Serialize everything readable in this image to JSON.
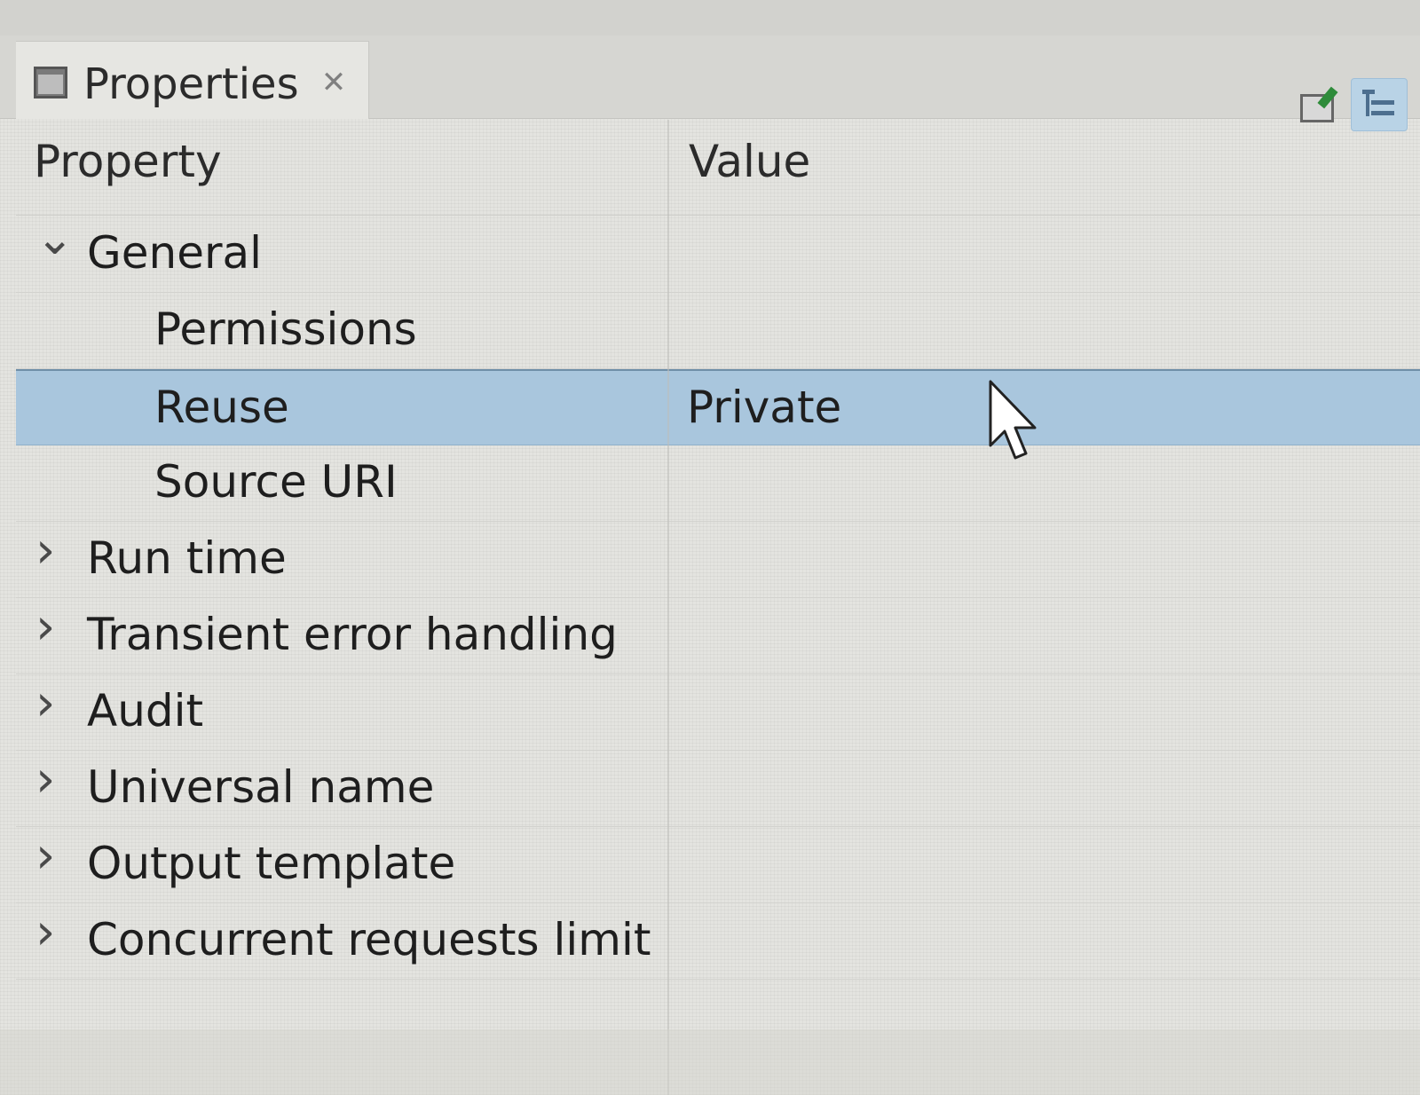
{
  "tab": {
    "title": "Properties",
    "icon": "properties-view-icon",
    "close_icon": "close-icon"
  },
  "toolbar": {
    "buttons": [
      {
        "icon": "edit-icon"
      },
      {
        "icon": "tree-view-icon",
        "active": true
      }
    ]
  },
  "table": {
    "headers": {
      "property": "Property",
      "value": "Value"
    },
    "rows": [
      {
        "label": "General",
        "value": "",
        "expandable": true,
        "expanded": true,
        "level": 0
      },
      {
        "label": "Permissions",
        "value": "",
        "level": 1
      },
      {
        "label": "Reuse",
        "value": "Private",
        "level": 1,
        "selected": true
      },
      {
        "label": "Source URI",
        "value": "",
        "level": 1
      },
      {
        "label": "Run time",
        "value": "",
        "expandable": true,
        "expanded": false,
        "level": 0
      },
      {
        "label": "Transient error handling",
        "value": "",
        "expandable": true,
        "expanded": false,
        "level": 0
      },
      {
        "label": "Audit",
        "value": "",
        "expandable": true,
        "expanded": false,
        "level": 0
      },
      {
        "label": "Universal name",
        "value": "",
        "expandable": true,
        "expanded": false,
        "level": 0
      },
      {
        "label": "Output template",
        "value": "",
        "expandable": true,
        "expanded": false,
        "level": 0
      },
      {
        "label": "Concurrent requests limit",
        "value": "",
        "expandable": true,
        "expanded": false,
        "level": 0
      }
    ]
  },
  "colors": {
    "selection": "#a9c6dd",
    "panel_bg": "#e4e4e0",
    "text": "#1e1e1e"
  }
}
